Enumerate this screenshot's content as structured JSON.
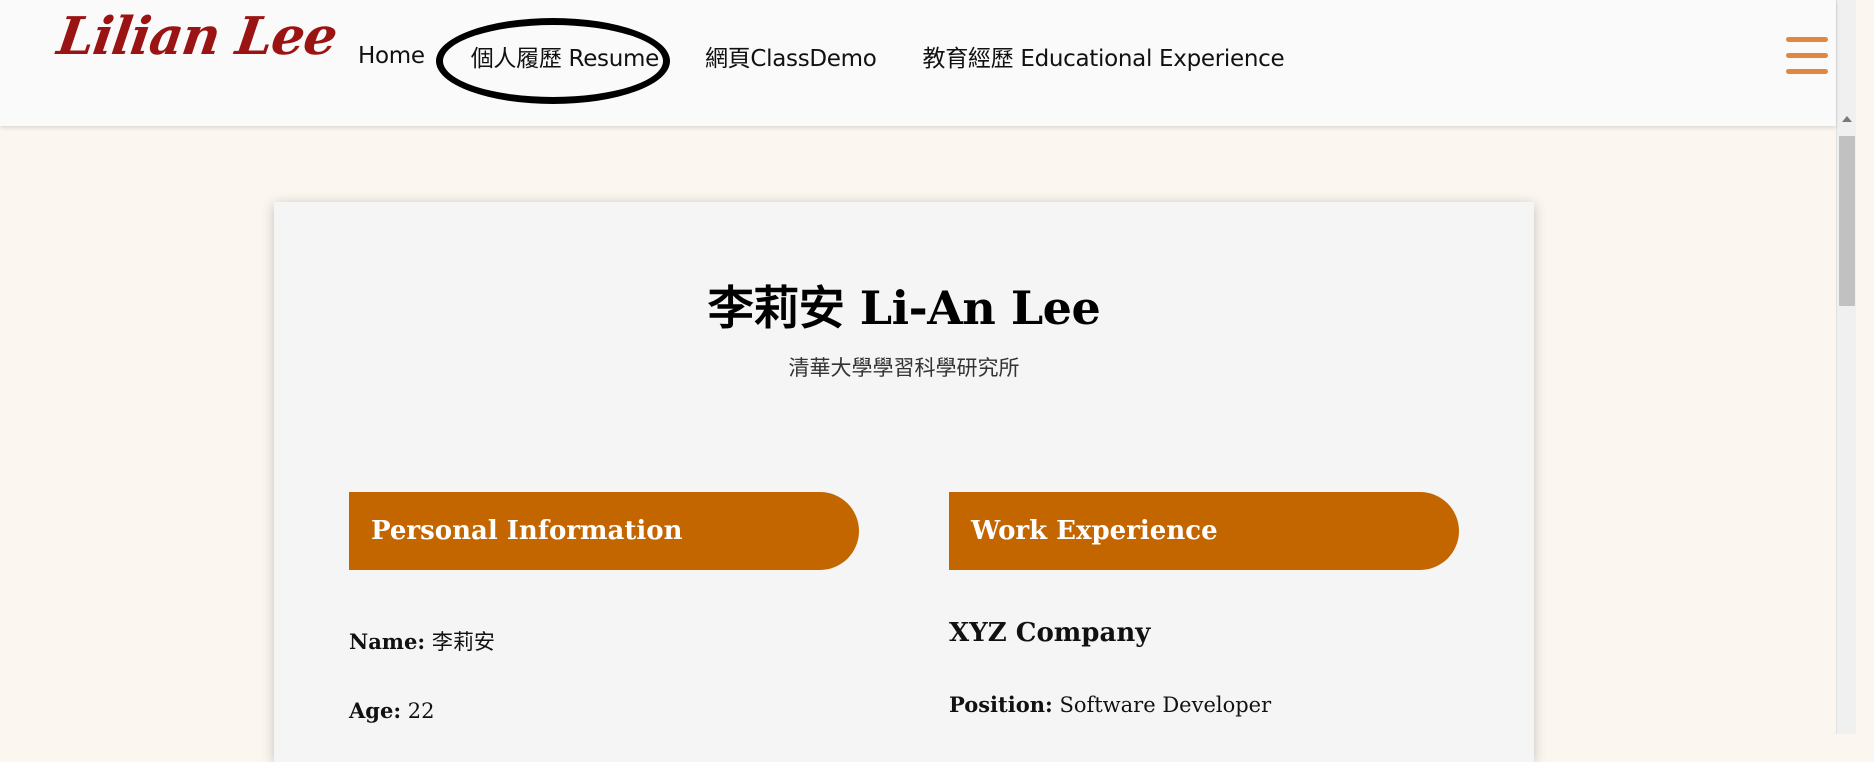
{
  "header": {
    "logo": "Lilian Lee",
    "nav": [
      {
        "label": "Home"
      },
      {
        "label": "個人履歷 Resume"
      },
      {
        "label": "網頁ClassDemo"
      },
      {
        "label": "教育經歷 Educational Experience"
      }
    ],
    "menu_icon": "hamburger-icon"
  },
  "card": {
    "title": "李莉安 Li-An Lee",
    "subtitle": "清華大學學習科學研究所",
    "personal": {
      "heading": "Personal Information",
      "name_label": "Name:",
      "name_value": "李莉安",
      "age_label": "Age:",
      "age_value": "22"
    },
    "work": {
      "heading": "Work Experience",
      "company": "XYZ Company",
      "position_label": "Position:",
      "position_value": "Software Developer"
    }
  },
  "colors": {
    "accent": "#c46600",
    "logo": "#9b1414",
    "menu_icon": "#e3873e",
    "page_bg": "#fcf6f0",
    "card_bg": "#f5f5f5"
  }
}
